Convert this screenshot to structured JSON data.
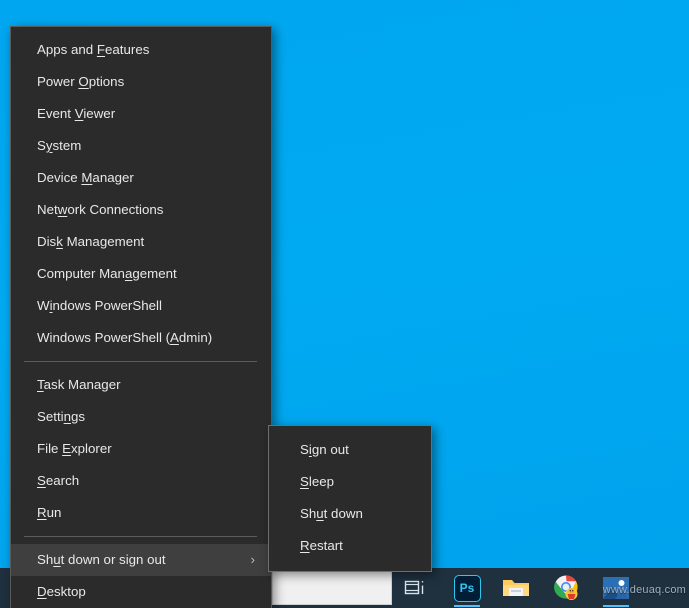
{
  "desktop": {
    "background_color": "#00a8f0"
  },
  "winx_menu": {
    "name": "Power User menu",
    "groups": [
      {
        "items": [
          {
            "label": "Apps and Features",
            "accel": "F",
            "accel_index": 9
          },
          {
            "label": "Power Options",
            "accel": "O",
            "accel_index": 6
          },
          {
            "label": "Event Viewer",
            "accel": "V",
            "accel_index": 6
          },
          {
            "label": "System",
            "accel": "y",
            "accel_index": 1
          },
          {
            "label": "Device Manager",
            "accel": "M",
            "accel_index": 7
          },
          {
            "label": "Network Connections",
            "accel": "w",
            "accel_index": 3
          },
          {
            "label": "Disk Management",
            "accel": "k",
            "accel_index": 3
          },
          {
            "label": "Computer Management",
            "accel": "g",
            "accel_index": 12
          },
          {
            "label": "Windows PowerShell",
            "accel": "i",
            "accel_index": 1
          },
          {
            "label": "Windows PowerShell (Admin)",
            "accel": "A",
            "accel_index": 20
          }
        ]
      },
      {
        "items": [
          {
            "label": "Task Manager",
            "accel": "T",
            "accel_index": 0
          },
          {
            "label": "Settings",
            "accel": "n",
            "accel_index": 5
          },
          {
            "label": "File Explorer",
            "accel": "E",
            "accel_index": 5
          },
          {
            "label": "Search",
            "accel": "S",
            "accel_index": 0
          },
          {
            "label": "Run",
            "accel": "R",
            "accel_index": 0
          }
        ]
      },
      {
        "items": [
          {
            "label": "Shut down or sign out",
            "accel": "u",
            "accel_index": 2,
            "selected": true,
            "has_submenu": true,
            "submenu_glyph": "›"
          },
          {
            "label": "Desktop",
            "accel": "D",
            "accel_index": 0
          }
        ]
      }
    ]
  },
  "submenu": {
    "name": "Shut down or sign out submenu",
    "items": [
      {
        "label": "Sign out",
        "accel": "i",
        "accel_index": 1
      },
      {
        "label": "Sleep",
        "accel": "S",
        "accel_index": 0
      },
      {
        "label": "Shut down",
        "accel": "u",
        "accel_index": 2
      },
      {
        "label": "Restart",
        "accel": "R",
        "accel_index": 0
      }
    ]
  },
  "taskbar": {
    "background_color": "#1f303f",
    "search": {
      "value": "",
      "placeholder": ""
    },
    "icons": [
      {
        "name": "task-view-icon",
        "label": "Task View"
      },
      {
        "name": "photoshop-icon",
        "label": "Ps"
      },
      {
        "name": "file-explorer-icon",
        "label": "File Explorer"
      },
      {
        "name": "chrome-icon",
        "label": "Google Chrome"
      },
      {
        "name": "photos-icon",
        "label": "Photos"
      }
    ]
  },
  "watermark": {
    "text": "www.deuaq.com"
  }
}
